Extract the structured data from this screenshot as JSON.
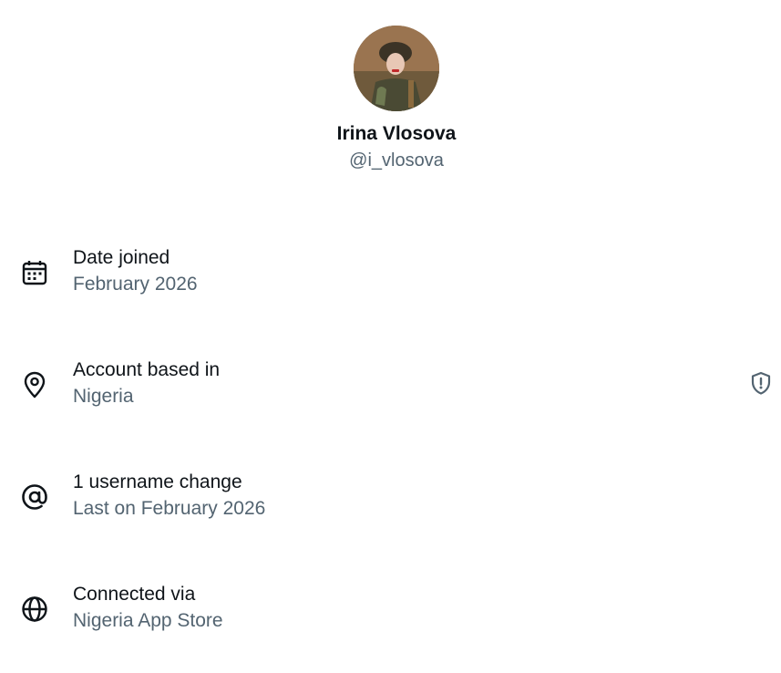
{
  "profile": {
    "display_name": "Irina Vlosova",
    "handle": "@i_vlosova",
    "avatar_icon": "profile-photo"
  },
  "rows": [
    {
      "icon": "calendar-icon",
      "title": "Date joined",
      "subtitle": "February 2026"
    },
    {
      "icon": "location-pin-icon",
      "title": "Account based in",
      "subtitle": "Nigeria",
      "trailing_icon": "shield-alert-icon"
    },
    {
      "icon": "at-sign-icon",
      "title": "1 username change",
      "subtitle": "Last on February 2026"
    },
    {
      "icon": "globe-icon",
      "title": "Connected via",
      "subtitle": "Nigeria App Store"
    }
  ],
  "colors": {
    "primary_text": "#0f1419",
    "secondary_text": "#536471",
    "background": "#ffffff"
  }
}
